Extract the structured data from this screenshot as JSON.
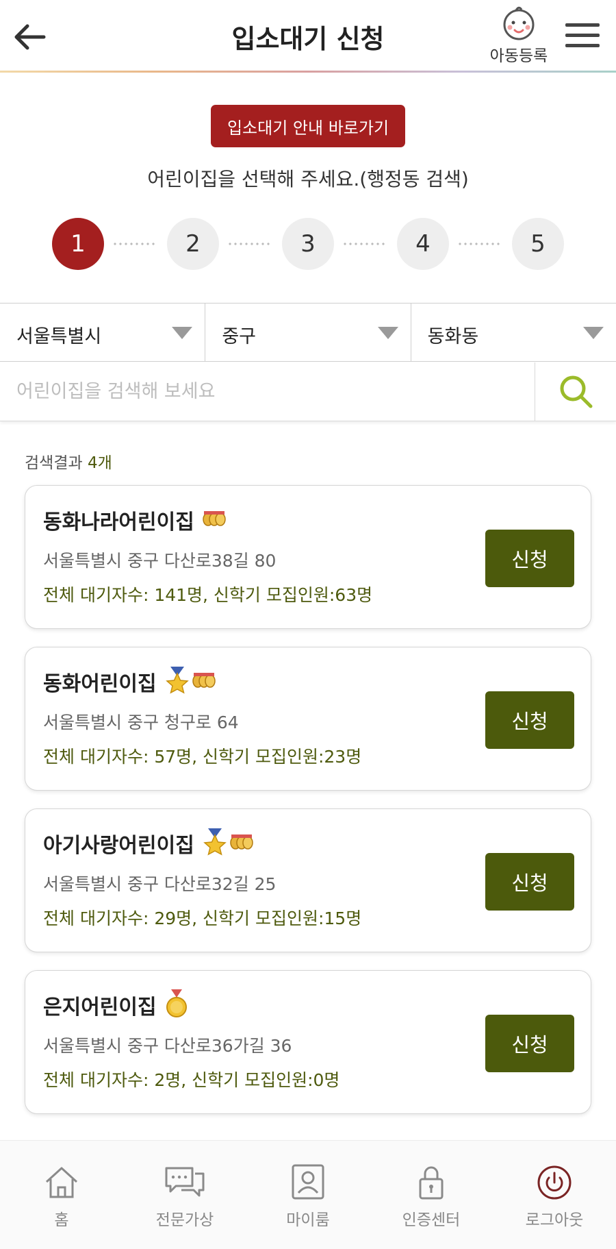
{
  "header": {
    "title": "입소대기 신청",
    "child_register_label": "아동등록"
  },
  "guide": {
    "button_label": "입소대기 안내 바로가기",
    "instruction": "어린이집을 선택해 주세요.(행정동 검색)"
  },
  "steps": {
    "current": 1,
    "items": [
      "1",
      "2",
      "3",
      "4",
      "5"
    ]
  },
  "regions": {
    "city": "서울특별시",
    "district": "중구",
    "dong": "동화동"
  },
  "search": {
    "placeholder": "어린이집을 검색해 보세요",
    "value": ""
  },
  "results": {
    "label": "검색결과",
    "count": "4개",
    "items": [
      {
        "name": "동화나라어린이집",
        "badges": [
          "coins-icon"
        ],
        "address": "서울특별시 중구 다산로38길 80",
        "stats": "전체 대기자수: 141명, 신학기 모집인원:63명",
        "apply_label": "신청"
      },
      {
        "name": "동화어린이집",
        "badges": [
          "star-medal-icon",
          "coins-icon"
        ],
        "address": "서울특별시 중구 청구로 64",
        "stats": "전체 대기자수: 57명, 신학기 모집인원:23명",
        "apply_label": "신청"
      },
      {
        "name": "아기사랑어린이집",
        "badges": [
          "star-medal-icon",
          "coins-icon"
        ],
        "address": "서울특별시 중구 다산로32길 25",
        "stats": "전체 대기자수: 29명, 신학기 모집인원:15명",
        "apply_label": "신청"
      },
      {
        "name": "은지어린이집",
        "badges": [
          "gold-medal-icon"
        ],
        "address": "서울특별시 중구 다산로36가길 36",
        "stats": "전체 대기자수: 2명, 신학기 모집인원:0명",
        "apply_label": "신청"
      }
    ]
  },
  "bottom_nav": {
    "items": [
      {
        "label": "홈",
        "icon": "home-icon"
      },
      {
        "label": "전문가상",
        "icon": "chat-icon"
      },
      {
        "label": "마이룸",
        "icon": "person-icon"
      },
      {
        "label": "인증센터",
        "icon": "lock-icon"
      },
      {
        "label": "로그아웃",
        "icon": "power-icon"
      }
    ]
  },
  "colors": {
    "brand_red": "#a41f1f",
    "apply_green": "#4c5a0c",
    "stats_green": "#4e5a0e"
  }
}
